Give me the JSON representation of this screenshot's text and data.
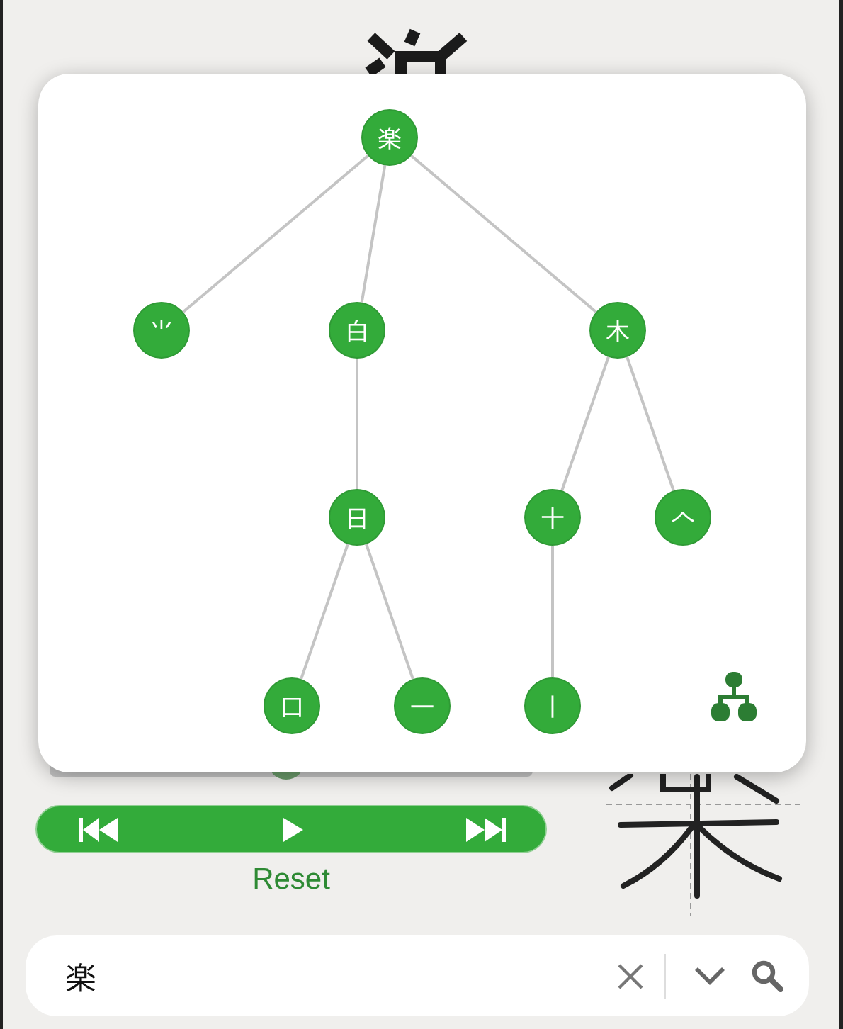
{
  "tree": {
    "label": "楽",
    "children": [
      {
        "label": "⺌"
      },
      {
        "label": "白",
        "children": [
          {
            "label": "日",
            "children": [
              {
                "label": "口"
              },
              {
                "label": "一"
              }
            ]
          }
        ]
      },
      {
        "label": "木",
        "children": [
          {
            "label": "十",
            "children": [
              {
                "label": "丨"
              }
            ]
          },
          {
            "label": "𠆢"
          }
        ]
      }
    ]
  },
  "playback": {
    "level": 0.49
  },
  "reset_label": "Reset",
  "search": {
    "value": "楽"
  }
}
